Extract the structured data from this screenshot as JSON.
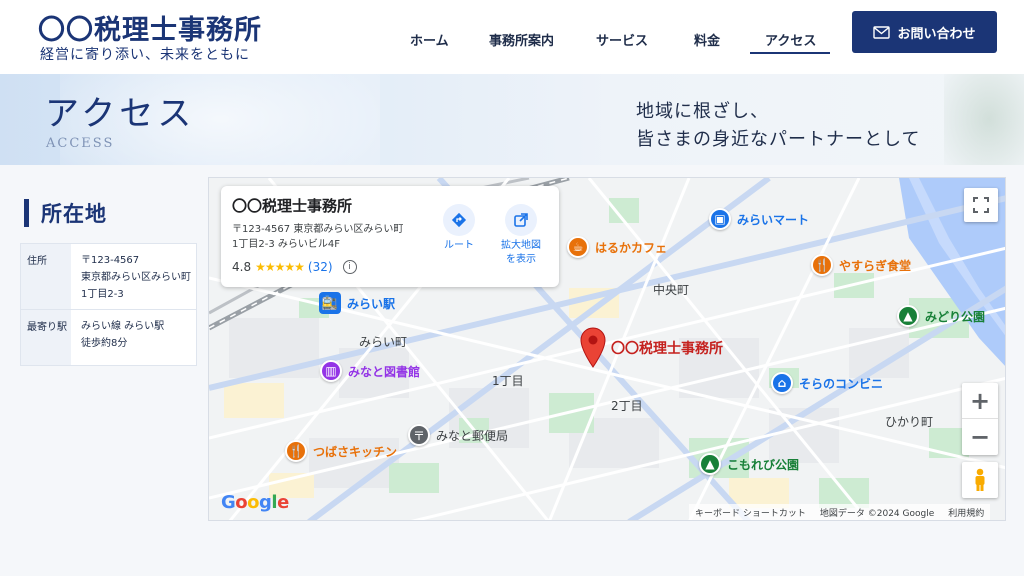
{
  "header": {
    "logo_title": "〇〇税理士事務所",
    "logo_subtitle": "経営に寄り添い、未来をともに",
    "nav": [
      {
        "label": "ホーム"
      },
      {
        "label": "事務所案内"
      },
      {
        "label": "サービス"
      },
      {
        "label": "料金"
      },
      {
        "label": "アクセス",
        "active": true
      }
    ],
    "contact_label": "お問い合わせ",
    "contact_icon": "mail-icon",
    "brand_color": "#1b3576"
  },
  "hero": {
    "title": "アクセス",
    "title_en": "ACCESS",
    "copy_line1": "地域に根ざし、",
    "copy_line2": "皆さまの身近なパートナーとして"
  },
  "location": {
    "section_title": "所在地",
    "rows": [
      {
        "label": "住所",
        "lines": [
          "〒123-4567",
          "東京都みらい区みらい町",
          "1丁目2-3"
        ]
      },
      {
        "label": "最寄り駅",
        "lines": [
          "みらい線 みらい駅",
          "徒歩約8分"
        ]
      }
    ]
  },
  "map": {
    "place_card": {
      "name": "〇〇税理士事務所",
      "address_line1": "〒123-4567 東京都みらい区みらい町",
      "address_line2": "1丁目2-3 みらいビル4F",
      "rating": "4.8",
      "stars": "★★★★★",
      "review_count": "(32)",
      "route_label": "ルート",
      "enlarge_label_1": "拡大地図",
      "enlarge_label_2": "を表示"
    },
    "pin_label": "〇〇税理士事務所",
    "pois": {
      "station": "みらい駅",
      "mart": "みらいマート",
      "cafe": "はるかカフェ",
      "diner": "やすらぎ食堂",
      "park1": "みどり公園",
      "library": "みなと図書館",
      "convenience": "そらのコンビニ",
      "post": "みなと郵便局",
      "kitchen": "つばさキッチン",
      "park2": "こもれび公園"
    },
    "areas": {
      "chuo": "中央町",
      "mirai": "みらい町",
      "chome1": "1丁目",
      "chome2": "2丁目",
      "hikari": "ひかり町"
    },
    "google": "Google",
    "attribution": {
      "shortcuts": "キーボード ショートカット",
      "data": "地図データ ©2024 Google",
      "terms": "利用規約"
    },
    "zoom_in": "+",
    "zoom_out": "−"
  }
}
